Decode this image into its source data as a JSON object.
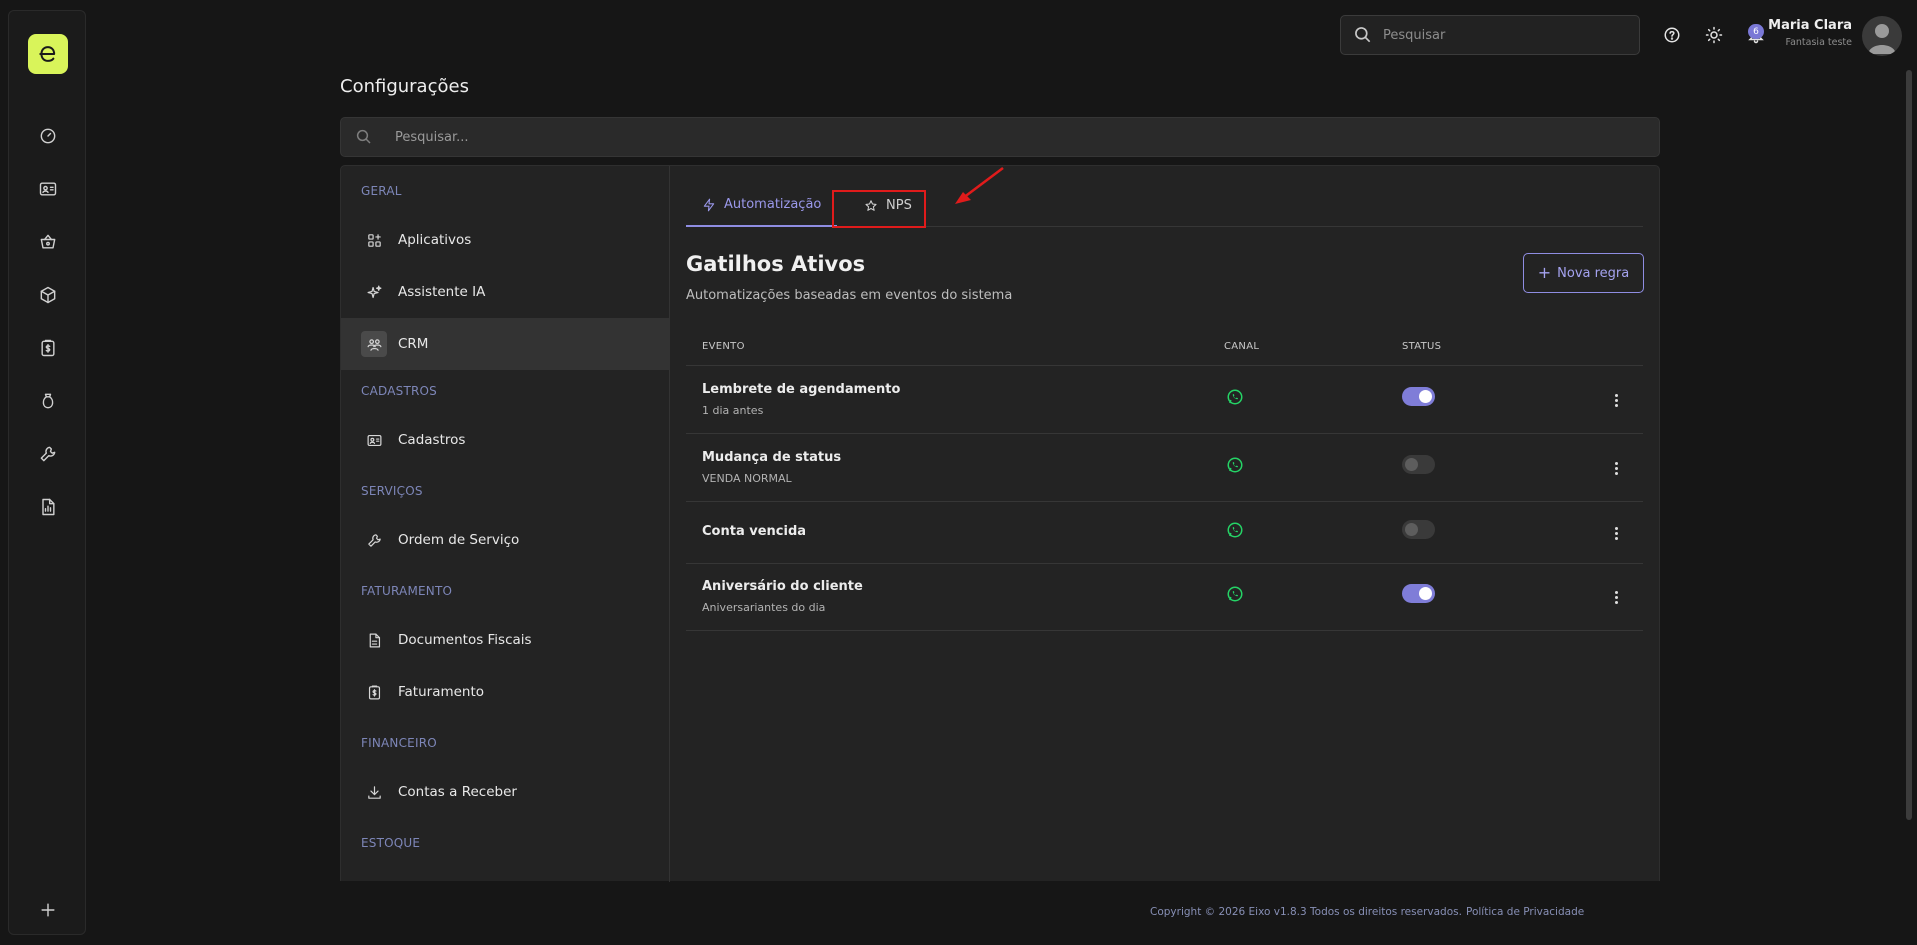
{
  "header": {
    "search_placeholder": "Pesquisar",
    "notification_count": "6",
    "user_name": "Maria Clara",
    "user_company": "Fantasia teste"
  },
  "page": {
    "title": "Configurações",
    "search_placeholder": "Pesquisar..."
  },
  "settings_nav": {
    "sections": {
      "geral": "GERAL",
      "cadastros": "CADASTROS",
      "servicos": "SERVIÇOS",
      "faturamento": "FATURAMENTO",
      "financeiro": "FINANCEIRO",
      "estoque": "ESTOQUE"
    },
    "items": {
      "aplicativos": "Aplicativos",
      "assistente": "Assistente IA",
      "crm": "CRM",
      "cadastros": "Cadastros",
      "ordem": "Ordem de Serviço",
      "documentos": "Documentos Fiscais",
      "faturamento": "Faturamento",
      "contas": "Contas a Receber"
    },
    "active_item": "CRM"
  },
  "tabs": {
    "automatizacao": "Automatização",
    "nps": "NPS",
    "active": "Automatização"
  },
  "content": {
    "title": "Gatilhos Ativos",
    "subtitle": "Automatizações baseadas em eventos do sistema",
    "new_rule_label": "Nova regra"
  },
  "table": {
    "headers": {
      "evento": "EVENTO",
      "canal": "CANAL",
      "status": "STATUS"
    },
    "rows": [
      {
        "title": "Lembrete de agendamento",
        "subtitle": "1 dia antes",
        "channel": "whatsapp-icon",
        "enabled": true
      },
      {
        "title": "Mudança de status",
        "subtitle": "VENDA NORMAL",
        "channel": "whatsapp-icon",
        "enabled": false
      },
      {
        "title": "Conta vencida",
        "subtitle": "",
        "channel": "whatsapp-icon",
        "enabled": false
      },
      {
        "title": "Aniversário do cliente",
        "subtitle": "Aniversariantes do dia",
        "channel": "whatsapp-icon",
        "enabled": true
      }
    ]
  },
  "footer": {
    "copyright": "Copyright © 2026 Eixo v1.8.3 Todos os direitos reservados.",
    "privacy": "Política de Privacidade"
  },
  "colors": {
    "accent": "#8f8de2",
    "brand": "#d9f45a",
    "whatsapp": "#25d366",
    "annotation": "#e01b1b"
  }
}
